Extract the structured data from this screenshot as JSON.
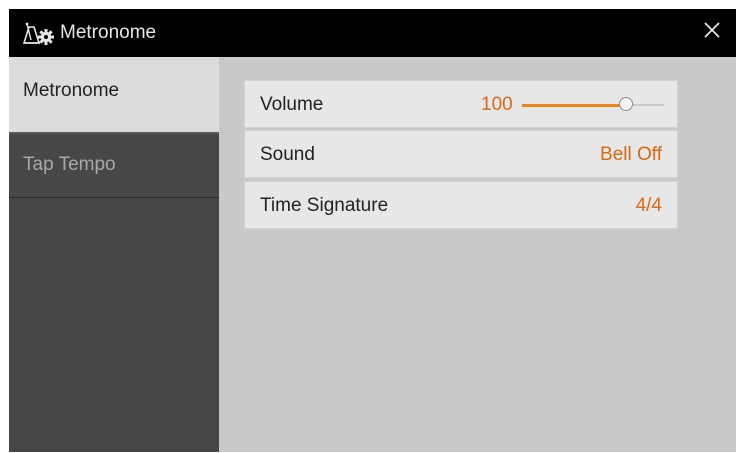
{
  "window": {
    "title": "Metronome",
    "title_icon": "metronome-gear-icon",
    "close_icon": "close-icon"
  },
  "sidebar": {
    "tabs": [
      {
        "label": "Metronome",
        "active": true
      },
      {
        "label": "Tap Tempo",
        "active": false
      }
    ]
  },
  "settings": {
    "volume": {
      "label": "Volume",
      "value": "100",
      "level": 0.73
    },
    "sound": {
      "label": "Sound",
      "value": "Bell Off"
    },
    "time_signature": {
      "label": "Time Signature",
      "value": "4/4"
    }
  },
  "colors": {
    "accent": "#d86a14",
    "slider_fill": "#e8861e",
    "titlebar": "#000000",
    "sidebar": "#474747",
    "content_bg": "#c9c9c9"
  }
}
